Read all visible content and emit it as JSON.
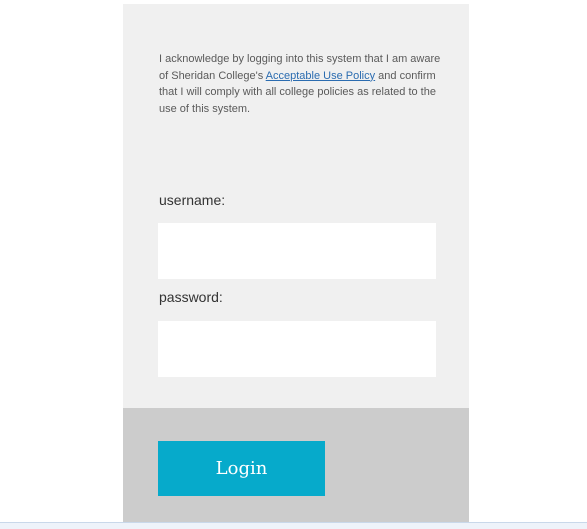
{
  "notice": {
    "before_link": "I acknowledge by logging into this system that I am aware of Sheridan College's ",
    "link_text": "Acceptable Use Policy",
    "after_link": " and confirm that I will comply with all college policies as related to the use of this system."
  },
  "form": {
    "username_label": "username:",
    "username_value": "",
    "password_label": "password:",
    "password_value": "",
    "login_label": "Login"
  },
  "colors": {
    "panel_bg": "#f0f0f0",
    "footer_bg": "#cccccc",
    "login_button_bg": "#06aacb",
    "link": "#2b6cb0"
  }
}
